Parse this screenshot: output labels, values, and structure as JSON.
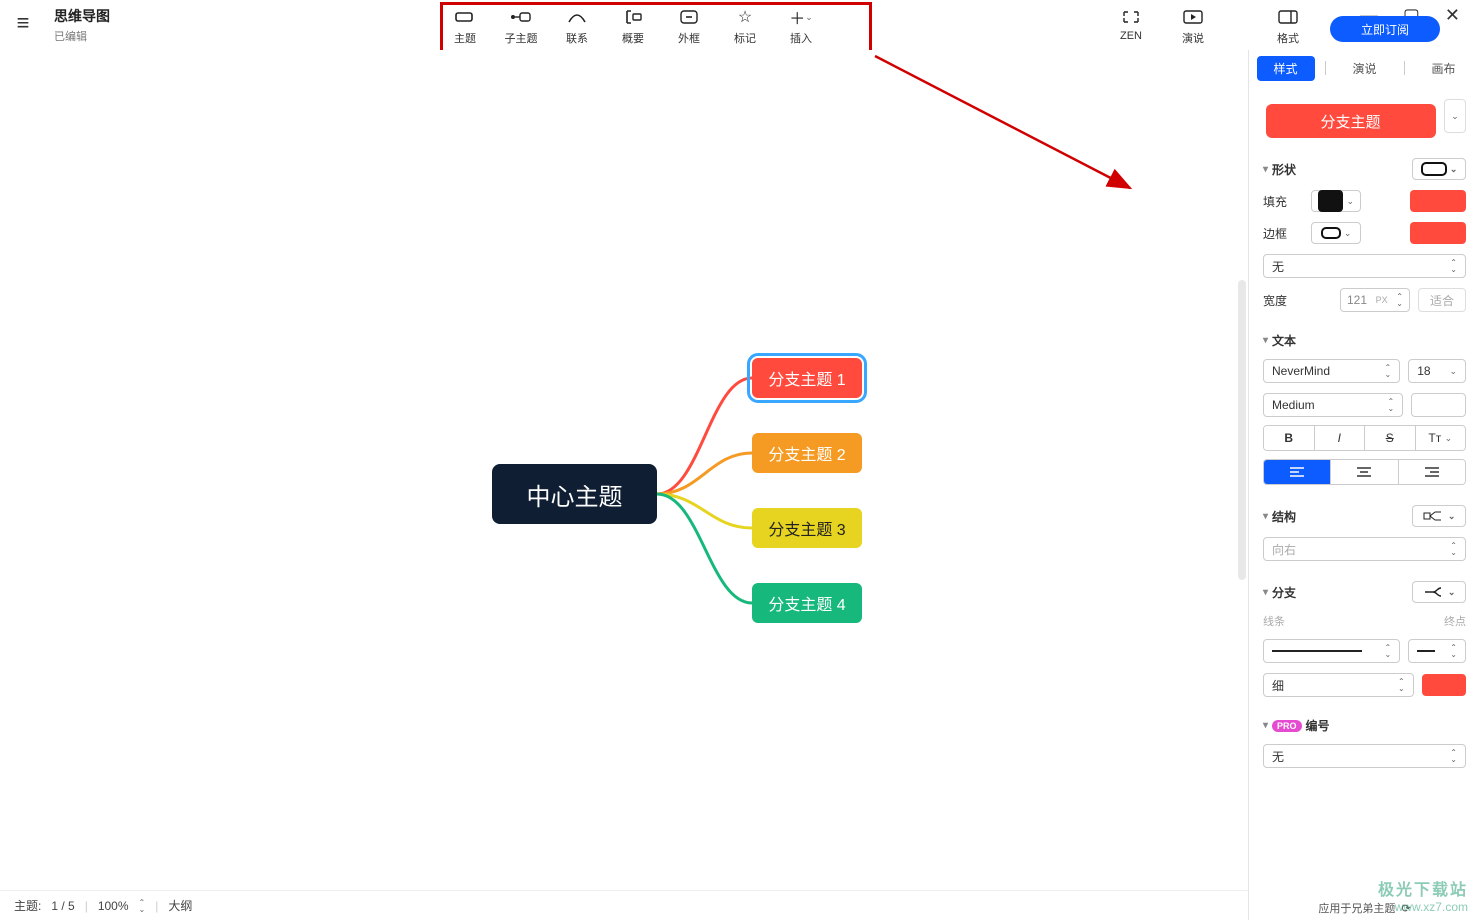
{
  "window": {
    "title": "思维导图",
    "subtitle": "已编辑"
  },
  "toolbar": {
    "items": [
      {
        "label": "主题",
        "icon": "topic"
      },
      {
        "label": "子主题",
        "icon": "subtopic"
      },
      {
        "label": "联系",
        "icon": "relation"
      },
      {
        "label": "概要",
        "icon": "summary"
      },
      {
        "label": "外框",
        "icon": "boundary"
      },
      {
        "label": "标记",
        "icon": "marker"
      },
      {
        "label": "插入",
        "icon": "insert"
      }
    ],
    "right": [
      {
        "label": "ZEN",
        "icon": "zen"
      },
      {
        "label": "演说",
        "icon": "pitch"
      }
    ],
    "format": {
      "label": "格式",
      "icon": "format"
    },
    "subscribe": "立即订阅"
  },
  "panel": {
    "tabs": {
      "style": "样式",
      "pitch": "演说",
      "canvas": "画布"
    },
    "branch_button": "分支主题",
    "shape": {
      "title": "形状",
      "fill": "填充",
      "border": "边框",
      "none": "无",
      "width_label": "宽度",
      "width_value": "121",
      "width_unit": "PX",
      "fit": "适合"
    },
    "text": {
      "title": "文本",
      "font": "NeverMind",
      "size": "18",
      "weight": "Medium",
      "align": "left",
      "bold": "B",
      "italic": "I",
      "strike": "S",
      "case": "Tᴛ"
    },
    "structure": {
      "title": "结构",
      "direction": "向右"
    },
    "branch": {
      "title": "分支",
      "line_label": "线条",
      "end_label": "终点",
      "thickness": "细"
    },
    "number": {
      "title": "编号",
      "value": "无",
      "pro": "PRO"
    },
    "apply": "应用于兄弟主题"
  },
  "mindmap": {
    "central": "中心主题",
    "branches": [
      {
        "label": "分支主题 1",
        "color": "#ff4a3d",
        "selected": true
      },
      {
        "label": "分支主题 2",
        "color": "#f59a23"
      },
      {
        "label": "分支主题 3",
        "color": "#e7d420"
      },
      {
        "label": "分支主题 4",
        "color": "#16b87c"
      }
    ]
  },
  "status": {
    "topic_label": "主题:",
    "topic_value": "1 / 5",
    "zoom": "100%",
    "outline": "大纲"
  },
  "watermark": {
    "l1": "极光下载站",
    "l2": "www.xz7.com"
  }
}
